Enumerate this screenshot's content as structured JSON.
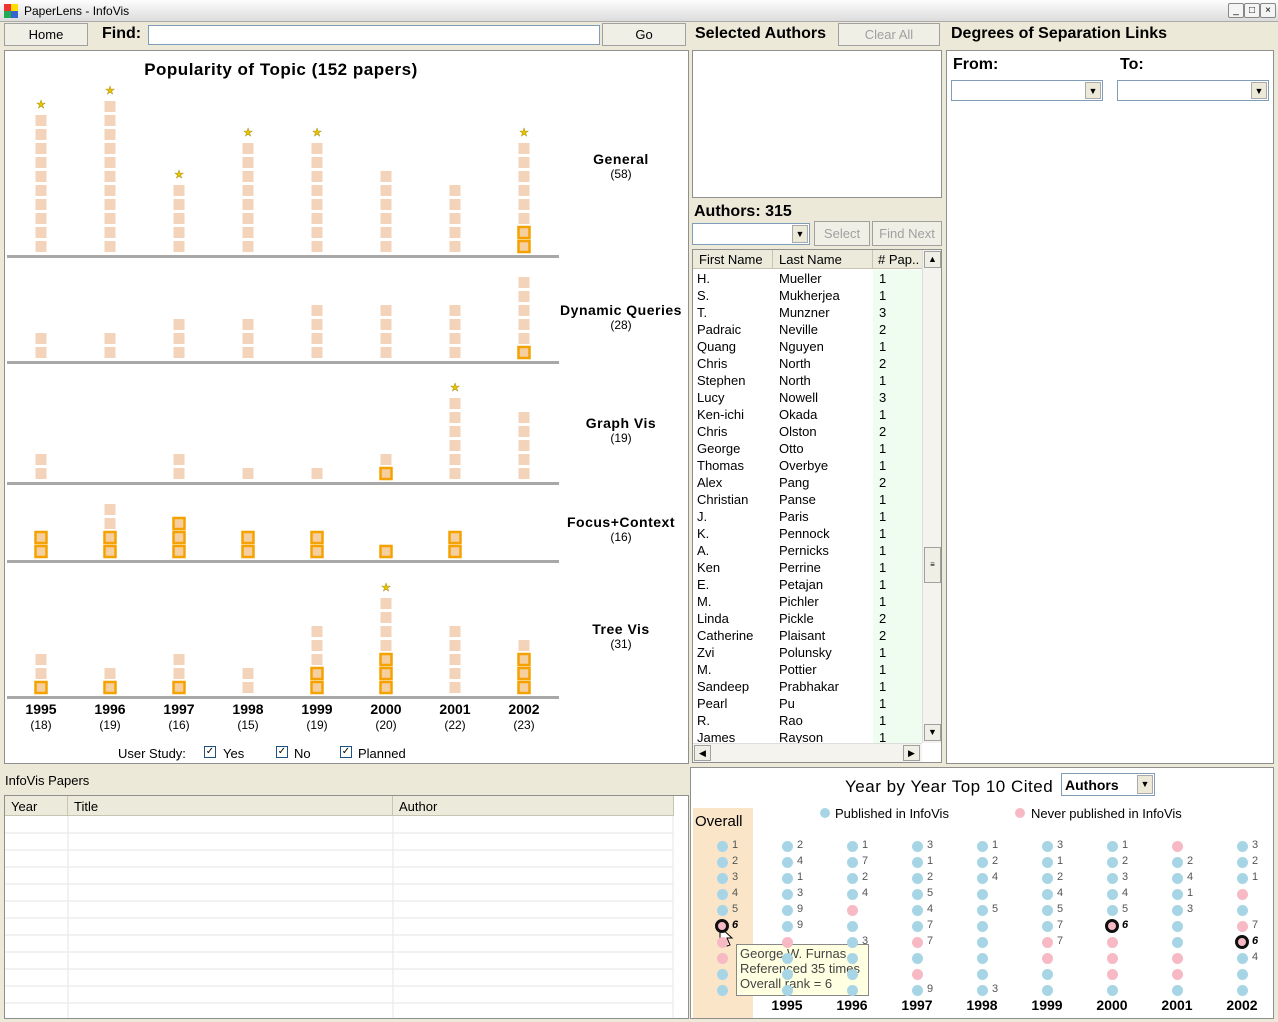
{
  "window": {
    "title": "PaperLens - InfoVis"
  },
  "toolbar": {
    "home": "Home",
    "find_label": "Find:",
    "find_value": "",
    "go": "Go"
  },
  "popularity": {
    "title": "Popularity of Topic (152 papers)",
    "topics": [
      {
        "name": "General",
        "count": "(58)"
      },
      {
        "name": "Dynamic Queries",
        "count": "(28)"
      },
      {
        "name": "Graph Vis",
        "count": "(19)"
      },
      {
        "name": "Focus+Context",
        "count": "(16)"
      },
      {
        "name": "Tree Vis",
        "count": "(31)"
      }
    ],
    "years": [
      {
        "year": "1995",
        "count": "(18)"
      },
      {
        "year": "1996",
        "count": "(19)"
      },
      {
        "year": "1997",
        "count": "(16)"
      },
      {
        "year": "1998",
        "count": "(15)"
      },
      {
        "year": "1999",
        "count": "(19)"
      },
      {
        "year": "2000",
        "count": "(20)"
      },
      {
        "year": "2001",
        "count": "(22)"
      },
      {
        "year": "2002",
        "count": "(23)"
      }
    ],
    "user_study_label": "User Study:",
    "yes": "Yes",
    "no": "No",
    "planned": "Planned"
  },
  "chart_data": {
    "type": "bar",
    "categories": [
      "1995",
      "1996",
      "1997",
      "1998",
      "1999",
      "2000",
      "2001",
      "2002"
    ],
    "series": [
      {
        "name": "General",
        "values": [
          10,
          11,
          5,
          8,
          8,
          6,
          5,
          8
        ]
      },
      {
        "name": "Dynamic Queries",
        "values": [
          2,
          2,
          3,
          3,
          4,
          4,
          4,
          6
        ]
      },
      {
        "name": "Graph Vis",
        "values": [
          2,
          0,
          2,
          1,
          1,
          2,
          6,
          5
        ]
      },
      {
        "name": "Focus+Context",
        "values": [
          2,
          4,
          3,
          2,
          2,
          1,
          2,
          0
        ]
      },
      {
        "name": "Tree Vis",
        "values": [
          3,
          2,
          3,
          2,
          5,
          7,
          5,
          4
        ]
      }
    ],
    "highlighted": [
      [
        0,
        0,
        0,
        0,
        0,
        0,
        0,
        2
      ],
      [
        0,
        0,
        0,
        0,
        0,
        0,
        0,
        1
      ],
      [
        0,
        0,
        0,
        0,
        0,
        1,
        0,
        0
      ],
      [
        2,
        2,
        3,
        2,
        2,
        1,
        2,
        0
      ],
      [
        1,
        1,
        1,
        0,
        2,
        3,
        0,
        3
      ]
    ],
    "starred": [
      [
        1,
        1,
        1,
        1,
        1,
        0,
        0,
        1
      ],
      [
        0,
        0,
        0,
        0,
        0,
        0,
        0,
        0
      ],
      [
        0,
        0,
        0,
        0,
        0,
        0,
        1,
        0
      ],
      [
        0,
        0,
        0,
        0,
        0,
        0,
        0,
        0
      ],
      [
        0,
        0,
        0,
        0,
        0,
        1,
        0,
        0
      ]
    ]
  },
  "selected_authors": {
    "title": "Selected Authors",
    "clear_all": "Clear All"
  },
  "authors": {
    "title": "Authors: 315",
    "select": "Select",
    "find_next": "Find Next",
    "columns": [
      "First Name",
      "Last Name",
      "# Pap.."
    ],
    "rows": [
      [
        "H.",
        "Mueller",
        "1"
      ],
      [
        "S.",
        "Mukherjea",
        "1"
      ],
      [
        "T.",
        "Munzner",
        "3"
      ],
      [
        "Padraic",
        "Neville",
        "2"
      ],
      [
        "Quang",
        "Nguyen",
        "1"
      ],
      [
        "Chris",
        "North",
        "2"
      ],
      [
        "Stephen",
        "North",
        "1"
      ],
      [
        "Lucy",
        "Nowell",
        "3"
      ],
      [
        "Ken-ichi",
        "Okada",
        "1"
      ],
      [
        "Chris",
        "Olston",
        "2"
      ],
      [
        "George",
        "Otto",
        "1"
      ],
      [
        "Thomas",
        "Overbye",
        "1"
      ],
      [
        "Alex",
        "Pang",
        "2"
      ],
      [
        "Christian",
        "Panse",
        "1"
      ],
      [
        "J.",
        "Paris",
        "1"
      ],
      [
        "K.",
        "Pennock",
        "1"
      ],
      [
        "A.",
        "Pernicks",
        "1"
      ],
      [
        "Ken",
        "Perrine",
        "1"
      ],
      [
        "E.",
        "Petajan",
        "1"
      ],
      [
        "M.",
        "Pichler",
        "1"
      ],
      [
        "Linda",
        "Pickle",
        "2"
      ],
      [
        "Catherine",
        "Plaisant",
        "2"
      ],
      [
        "Zvi",
        "Polunsky",
        "1"
      ],
      [
        "M.",
        "Pottier",
        "1"
      ],
      [
        "Sandeep",
        "Prabhakar",
        "1"
      ],
      [
        "Pearl",
        "Pu",
        "1"
      ],
      [
        "R.",
        "Rao",
        "1"
      ],
      [
        "James",
        "Rayson",
        "1"
      ]
    ]
  },
  "degrees": {
    "title": "Degrees of Separation Links",
    "from": "From:",
    "to": "To:"
  },
  "papers": {
    "title": "InfoVis Papers",
    "columns": [
      "Year",
      "Title",
      "Author"
    ]
  },
  "top10": {
    "title": "Year by Year Top 10 Cited",
    "mode": "Authors",
    "legend_published": "Published in InfoVis",
    "legend_never": "Never published in InfoVis",
    "overall": "Overall",
    "years": [
      "1995",
      "1996",
      "1997",
      "1998",
      "1999",
      "2000",
      "2001",
      "2002"
    ],
    "overall_ranks": [
      "1",
      "2",
      "3",
      "4",
      "5",
      "6",
      "",
      "",
      "",
      ""
    ],
    "year_ranks": [
      [
        "2",
        "4",
        "1",
        "3",
        "9",
        "9",
        "",
        "",
        "",
        ""
      ],
      [
        "1",
        "7",
        "2",
        "4",
        "",
        "",
        "3",
        "",
        "",
        ""
      ],
      [
        "3",
        "1",
        "2",
        "5",
        "4",
        "7",
        "7",
        "",
        "",
        "9"
      ],
      [
        "1",
        "2",
        "4",
        "",
        "5",
        "",
        "",
        "",
        "",
        "3"
      ],
      [
        "3",
        "1",
        "2",
        "4",
        "5",
        "7",
        "7",
        "",
        "",
        ""
      ],
      [
        "1",
        "2",
        "3",
        "4",
        "5",
        "6",
        "",
        "",
        "",
        ""
      ],
      [
        "",
        "2",
        "4",
        "1",
        "3",
        "",
        "",
        "",
        "",
        ""
      ],
      [
        "3",
        "2",
        "1",
        "",
        "",
        "7",
        "6",
        "4",
        "",
        ""
      ]
    ],
    "tooltip": {
      "line1": "George W. Furnas",
      "line2": "Referenced 35 times",
      "line3": "Overall rank = 6"
    }
  }
}
